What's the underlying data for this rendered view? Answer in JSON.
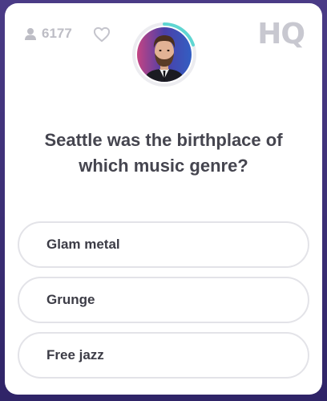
{
  "header": {
    "viewer_count": "6177",
    "logo": "HQ",
    "icons": [
      "person-icon",
      "heart-icon"
    ]
  },
  "host": {
    "avatar": "host-avatar",
    "timer_ring_color": "#5fd6d2"
  },
  "question": {
    "text": "Seattle was the birthplace of which music genre?"
  },
  "answers": [
    {
      "label": "Glam metal"
    },
    {
      "label": "Grunge"
    },
    {
      "label": "Free jazz"
    }
  ],
  "colors": {
    "background": "#3a2a6e",
    "card": "#ffffff",
    "accent": "#5fd6d2",
    "text": "#45454f"
  }
}
